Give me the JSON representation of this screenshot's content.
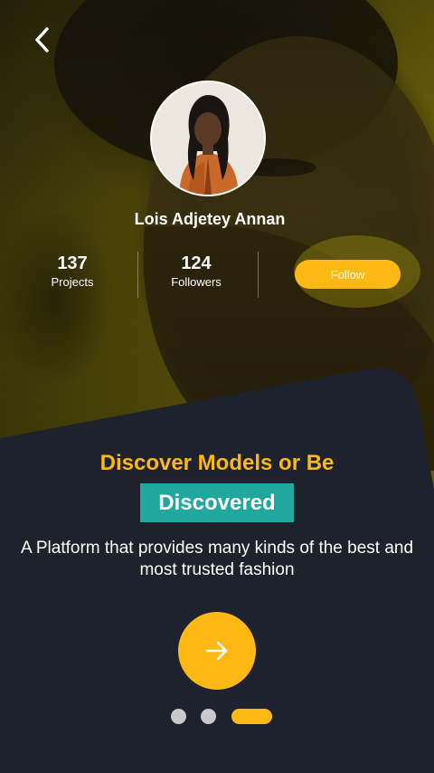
{
  "profile": {
    "name": "Lois Adjetey Annan",
    "stats": [
      {
        "value": "137",
        "label": "Projects"
      },
      {
        "value": "124",
        "label": "Followers"
      }
    ],
    "follow_label": "Follow"
  },
  "onboarding": {
    "headline": "Discover Models or Be",
    "highlight": "Discovered",
    "description": "A Platform that provides many kinds of  the best and most trusted fashion",
    "pager": {
      "count": 3,
      "active_index": 2
    }
  },
  "colors": {
    "accent": "#fdb814",
    "teal": "#20a79e",
    "card": "#1e222c",
    "hero_tint": "#6a620b"
  },
  "icons": {
    "back": "chevron-left-icon",
    "next": "arrow-right-icon"
  }
}
